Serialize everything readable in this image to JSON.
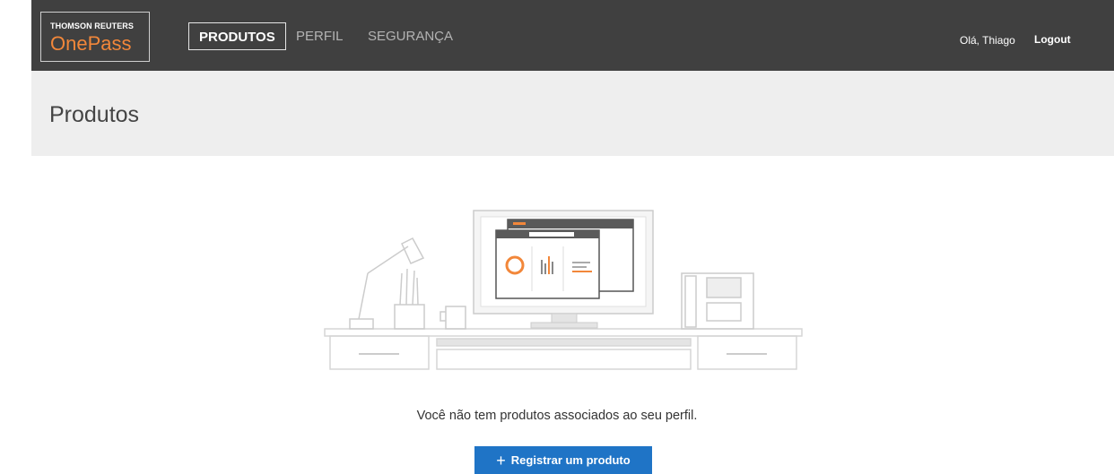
{
  "header": {
    "brand_top": "THOMSON REUTERS",
    "brand_name": "OnePass",
    "nav": [
      {
        "label": "PRODUTOS",
        "active": true
      },
      {
        "label": "PERFIL",
        "active": false
      },
      {
        "label": "SEGURANÇA",
        "active": false
      }
    ],
    "greeting": "Olá, Thiago",
    "logout_label": "Logout"
  },
  "page": {
    "title": "Produtos",
    "empty_message": "Você não tem produtos associados ao seu perfil.",
    "register_label": "Registrar um produto"
  },
  "colors": {
    "header_bg": "#404040",
    "title_bg": "#eeeeee",
    "brand_orange": "#f2873a",
    "button_blue": "#1f74c6"
  },
  "icons": {
    "register": "plus-icon"
  }
}
